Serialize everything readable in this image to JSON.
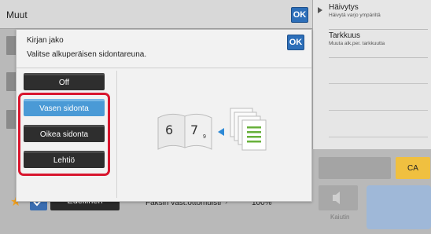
{
  "topbar": {
    "title": "Muut",
    "ok_label": "OK"
  },
  "right_panel": {
    "items": [
      {
        "title": "Häivytys",
        "subtitle": "Häivytä varjo ympäriltä"
      },
      {
        "title": "Tarkkuus",
        "subtitle": "Muuta alk.per. tarkkuutta"
      }
    ]
  },
  "dialog": {
    "title": "Kirjan jako",
    "subtitle": "Valitse alkuperäisen sidontareuna.",
    "ok_label": "OK",
    "options": [
      {
        "label": "Off",
        "selected": false
      },
      {
        "label": "Vasen sidonta",
        "selected": true
      },
      {
        "label": "Oikea sidonta",
        "selected": false
      },
      {
        "label": "Lehtiö",
        "selected": false
      }
    ],
    "illustration": {
      "pages_left": "6",
      "pages_right": "7",
      "page_sub": "9"
    }
  },
  "bottom": {
    "prev_label": "Edellinen",
    "memory_label": "Faksin vast.ottomuisti",
    "memory_value": "100%"
  },
  "side_buttons": {
    "ca_label": "CA",
    "speaker_label": "Kaiutin"
  },
  "colors": {
    "accent_blue": "#2d6fb9",
    "selected_blue": "#4a9ad6",
    "highlight_red": "#d8162e",
    "ca_yellow": "#f0c040"
  }
}
